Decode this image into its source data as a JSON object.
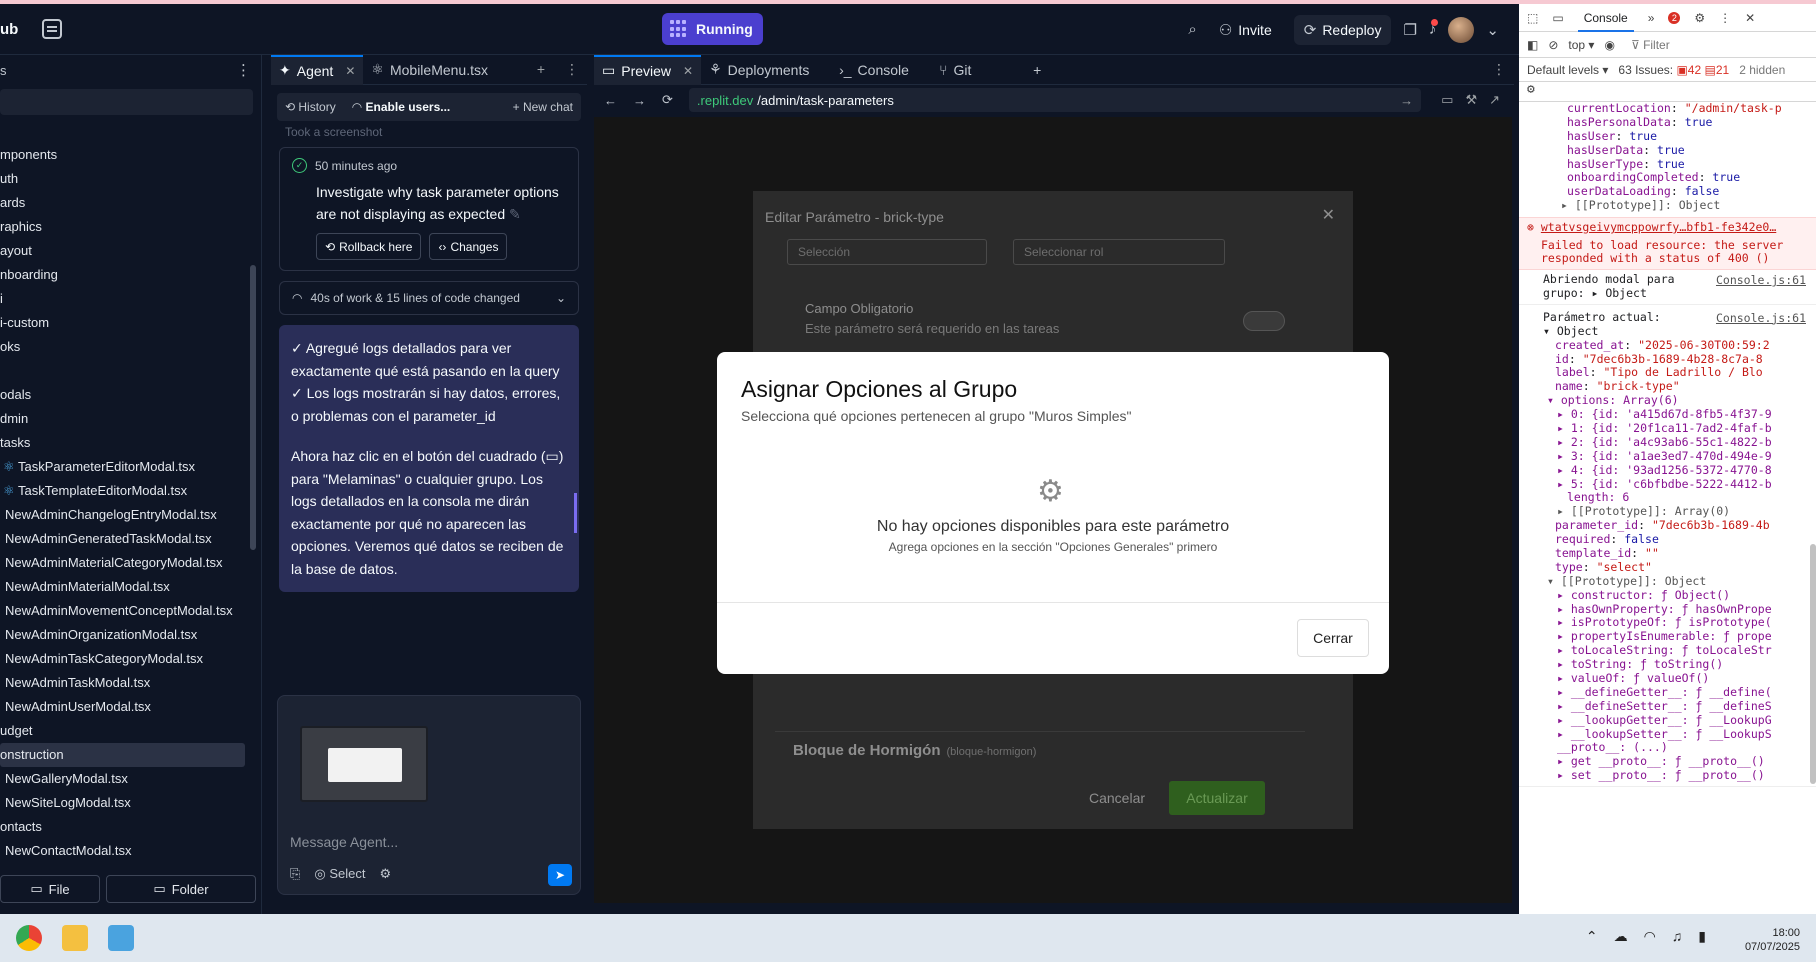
{
  "app": {
    "brand": "ub",
    "status": "Running",
    "invite": "Invite",
    "redeploy": "Redeploy"
  },
  "filetree": {
    "items": [
      {
        "label": "mponents",
        "kind": "folder"
      },
      {
        "label": "uth",
        "kind": "folder"
      },
      {
        "label": "ards",
        "kind": "folder"
      },
      {
        "label": "raphics",
        "kind": "folder"
      },
      {
        "label": "ayout",
        "kind": "folder"
      },
      {
        "label": "nboarding",
        "kind": "folder"
      },
      {
        "label": "i",
        "kind": "folder"
      },
      {
        "label": "i-custom",
        "kind": "folder"
      },
      {
        "label": "oks",
        "kind": "folder"
      },
      {
        "label": "",
        "kind": "folder"
      },
      {
        "label": "odals",
        "kind": "folder"
      },
      {
        "label": "dmin",
        "kind": "folder"
      },
      {
        "label": "tasks",
        "kind": "folder"
      },
      {
        "label": "TaskParameterEditorModal.tsx",
        "kind": "tsx"
      },
      {
        "label": "TaskTemplateEditorModal.tsx",
        "kind": "tsx"
      },
      {
        "label": "NewAdminChangelogEntryModal.tsx",
        "kind": "file"
      },
      {
        "label": "NewAdminGeneratedTaskModal.tsx",
        "kind": "file"
      },
      {
        "label": "NewAdminMaterialCategoryModal.tsx",
        "kind": "file"
      },
      {
        "label": "NewAdminMaterialModal.tsx",
        "kind": "file"
      },
      {
        "label": "NewAdminMovementConceptModal.tsx",
        "kind": "file"
      },
      {
        "label": "NewAdminOrganizationModal.tsx",
        "kind": "file"
      },
      {
        "label": "NewAdminTaskCategoryModal.tsx",
        "kind": "file"
      },
      {
        "label": "NewAdminTaskModal.tsx",
        "kind": "file"
      },
      {
        "label": "NewAdminUserModal.tsx",
        "kind": "file"
      },
      {
        "label": "udget",
        "kind": "folder"
      },
      {
        "label": "onstruction",
        "kind": "folder-selected"
      },
      {
        "label": "NewGalleryModal.tsx",
        "kind": "file"
      },
      {
        "label": "NewSiteLogModal.tsx",
        "kind": "file"
      },
      {
        "label": "ontacts",
        "kind": "folder"
      },
      {
        "label": "NewContactModal.tsx",
        "kind": "file"
      }
    ],
    "file_button": "File",
    "folder_button": "Folder"
  },
  "agent": {
    "tabs": [
      {
        "label": "Agent",
        "active": true
      },
      {
        "label": "MobileMenu.tsx",
        "active": false
      }
    ],
    "history": "History",
    "thread": "Enable users...",
    "new_chat": "New chat",
    "faded_line": "Took a screenshot",
    "checkpoint": {
      "time": "50 minutes ago",
      "title": "Investigate why task parameter options are not displaying as expected",
      "rollback": "Rollback here",
      "changes": "Changes"
    },
    "work_summary": "40s of work & 15 lines of code changed",
    "message": {
      "p1": "✓ Agregué logs detallados para ver exactamente qué está pasando en la query",
      "p2": "✓ Los logs mostrarán si hay datos, errores, o problemas con el parameter_id",
      "p3": "Ahora haz clic en el botón del cuadrado (▭) para \"Melaminas\" o cualquier grupo. Los logs detallados en la consola me dirán exactamente por qué no aparecen las opciones. Veremos qué datos se reciben de la base de datos."
    },
    "composer": {
      "placeholder": "Message Agent...",
      "select": "Select"
    }
  },
  "preview": {
    "tabs": [
      {
        "label": "Preview",
        "active": true
      },
      {
        "label": "Deployments",
        "active": false
      },
      {
        "label": "Console",
        "active": false
      },
      {
        "label": "Git",
        "active": false
      }
    ],
    "url_domain": ".replit.dev",
    "url_path": "/admin/task-parameters",
    "bg_modal": {
      "title": "Editar Parámetro - brick-type",
      "select1": "Selección",
      "select2": "Seleccionar rol",
      "field_title": "Campo Obligatorio",
      "field_sub": "Este parámetro será requerido en las tareas",
      "row_name": "Bloque de Hormigón",
      "row_slug": "(bloque-hormigon)",
      "cancel": "Cancelar",
      "update": "Actualizar"
    },
    "modal": {
      "title": "Asignar Opciones al Grupo",
      "subtitle": "Selecciona qué opciones pertenecen al grupo \"Muros Simples\"",
      "empty_title": "No hay opciones disponibles para este parámetro",
      "empty_sub": "Agrega opciones en la sección \"Opciones Generales\" primero",
      "close": "Cerrar"
    }
  },
  "devtools": {
    "tab": "Console",
    "context": "top",
    "filter": "Filter",
    "levels": "Default levels",
    "issues": "63 Issues:",
    "issues_red": "42",
    "issues_msgs": "21",
    "hidden": "2 hidden",
    "errors_count": "2",
    "obj_lines": [
      {
        "key": "currentLocation",
        "val": "\"/admin/task-p",
        "type": "s"
      },
      {
        "key": "hasPersonalData",
        "val": "true",
        "type": "b"
      },
      {
        "key": "hasUser",
        "val": "true",
        "type": "b"
      },
      {
        "key": "hasUserData",
        "val": "true",
        "type": "b"
      },
      {
        "key": "hasUserType",
        "val": "true",
        "type": "b"
      },
      {
        "key": "onboardingCompleted",
        "val": "true",
        "type": "b"
      },
      {
        "key": "userDataLoading",
        "val": "false",
        "type": "b"
      }
    ],
    "proto_object": "▸ [[Prototype]]: Object",
    "error_link": "wtatvsgeivymcppowrfy…bfb1-fe342e0…",
    "error_text": "Failed to load resource: the server responded with a status of 400 ()",
    "log1_text": "Abriendo modal para grupo:",
    "log1_obj": "▸ Object",
    "log1_src": "Console.js:61",
    "log2_text": "Parámetro actual:",
    "log2_src": "Console.js:61",
    "log2_obj": "▾ Object",
    "param_lines": [
      {
        "key": "created_at",
        "val": "\"2025-06-30T00:59:2",
        "type": "s"
      },
      {
        "key": "id",
        "val": "\"7dec6b3b-1689-4b28-8c7a-8",
        "type": "s"
      },
      {
        "key": "label",
        "val": "\"Tipo de Ladrillo / Blo",
        "type": "s"
      },
      {
        "key": "name",
        "val": "\"brick-type\"",
        "type": "s"
      }
    ],
    "options_head": "▾ options: Array(6)",
    "option_items": [
      "▸ 0: {id: 'a415d67d-8fb5-4f37-9",
      "▸ 1: {id: '20f1ca11-7ad2-4faf-b",
      "▸ 2: {id: 'a4c93ab6-55c1-4822-b",
      "▸ 3: {id: 'a1ae3ed7-470d-494e-9",
      "▸ 4: {id: '93ad1256-5372-4770-8",
      "▸ 5: {id: 'c6bfbdbe-5222-4412-b"
    ],
    "length_line": "length: 6",
    "array_proto": "▸ [[Prototype]]: Array(0)",
    "param_lines2": [
      {
        "key": "parameter_id",
        "val": "\"7dec6b3b-1689-4b",
        "type": "s"
      },
      {
        "key": "required",
        "val": "false",
        "type": "b"
      },
      {
        "key": "template_id",
        "val": "\"\"",
        "type": "s"
      },
      {
        "key": "type",
        "val": "\"select\"",
        "type": "s"
      }
    ],
    "proto_head": "▾ [[Prototype]]: Object",
    "proto_items": [
      "▸ constructor: ƒ Object()",
      "▸ hasOwnProperty: ƒ hasOwnPrope",
      "▸ isPrototypeOf: ƒ isPrototype(",
      "▸ propertyIsEnumerable: ƒ prope",
      "▸ toLocaleString: ƒ toLocaleStr",
      "▸ toString: ƒ toString()",
      "▸ valueOf: ƒ valueOf()",
      "▸ __defineGetter__: ƒ __define(",
      "▸ __defineSetter__: ƒ __defineS",
      "▸ __lookupGetter__: ƒ __LookupG",
      "▸ __lookupSetter__: ƒ __LookupS",
      "  __proto__: (...)",
      "▸ get __proto__: ƒ __proto__()",
      "▸ set __proto__: ƒ __proto__()"
    ]
  },
  "taskbar": {
    "time": "18:00",
    "date": "07/07/2025"
  }
}
